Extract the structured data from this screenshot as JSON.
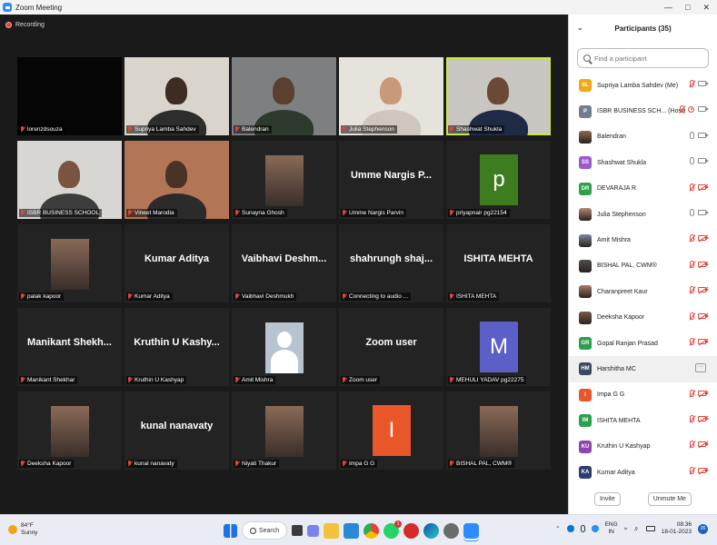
{
  "window": {
    "title": "Zoom Meeting"
  },
  "meeting": {
    "recording_label": "Recording"
  },
  "tiles": [
    {
      "label": "lorenzdsouza",
      "bigname": "",
      "kind": "black"
    },
    {
      "label": "Supriya Lamba Sahdev",
      "bigname": "",
      "kind": "video"
    },
    {
      "label": "Balendran",
      "bigname": "",
      "kind": "video"
    },
    {
      "label": "Julia Stephenson",
      "bigname": "",
      "kind": "video"
    },
    {
      "label": "Shashwat Shukla",
      "bigname": "",
      "kind": "video",
      "active": true
    },
    {
      "label": "ISBR BUSINESS SCHOOL",
      "bigname": "",
      "kind": "video"
    },
    {
      "label": "Vineet Marodia",
      "bigname": "",
      "kind": "video"
    },
    {
      "label": "Sunayna Ghosh",
      "bigname": "",
      "kind": "photo"
    },
    {
      "label": "Umme Nargis Parvin",
      "bigname": "Umme Nargis P...",
      "kind": "name"
    },
    {
      "label": "priyapnair pg22154",
      "bigname": "",
      "kind": "avatar",
      "letter": "p",
      "color": "#3e7d1f"
    },
    {
      "label": "palak kapoor",
      "bigname": "",
      "kind": "photo"
    },
    {
      "label": "Kumar Aditya",
      "bigname": "Kumar Aditya",
      "kind": "name"
    },
    {
      "label": "Vaibhavi Deshmukh",
      "bigname": "Vaibhavi Deshm...",
      "kind": "name"
    },
    {
      "label": "Connecting to audio ...",
      "bigname": "shahrungh shaj...",
      "kind": "name"
    },
    {
      "label": "ISHITA MEHTA",
      "bigname": "ISHITA MEHTA",
      "kind": "name"
    },
    {
      "label": "Manikant Shekhar",
      "bigname": "Manikant Shekh...",
      "kind": "name"
    },
    {
      "label": "Kruthin U Kashyap",
      "bigname": "Kruthin U Kashy...",
      "kind": "name"
    },
    {
      "label": "Amit Mishra",
      "bigname": "",
      "kind": "silhouette"
    },
    {
      "label": "Zoom user",
      "bigname": "Zoom user",
      "kind": "name"
    },
    {
      "label": "MEHULI YADAV pg22275",
      "bigname": "",
      "kind": "avatar",
      "letter": "M",
      "color": "#5b5fc7"
    },
    {
      "label": "Deeksha Kapoor",
      "bigname": "",
      "kind": "photo"
    },
    {
      "label": "kunal nanavaty",
      "bigname": "kunal nanavaty",
      "kind": "name"
    },
    {
      "label": "Niyati Thakur",
      "bigname": "",
      "kind": "photo"
    },
    {
      "label": "Impa G G",
      "bigname": "",
      "kind": "avatar",
      "letter": "I",
      "color": "#e8562a"
    },
    {
      "label": "BISHAL PAL, CWM®",
      "bigname": "",
      "kind": "photo"
    }
  ],
  "panel": {
    "title": "Participants (35)",
    "search_placeholder": "Find a participant",
    "invite_label": "Invite",
    "unmute_label": "Unmute Me",
    "participants": [
      {
        "initials": "SL",
        "color": "#f0a814",
        "name": "Supriya Lamba Sahdev (Me)",
        "mic": "off",
        "cam": "on",
        "rec": false
      },
      {
        "initials": "P",
        "color": "#6f7f8f",
        "name": "ISBR BUSINESS SCH... (Host)",
        "mic": "off",
        "cam": "on",
        "rec": true
      },
      {
        "initials": "",
        "color": "#8a6a55",
        "name": "Balendran",
        "mic": "on",
        "cam": "on",
        "rec": false
      },
      {
        "initials": "SS",
        "color": "#9b59d0",
        "name": "Shashwat Shukla",
        "mic": "on",
        "cam": "on",
        "rec": false
      },
      {
        "initials": "DR",
        "color": "#2aa14a",
        "name": "DEVARAJA R",
        "mic": "off",
        "cam": "off",
        "rec": false
      },
      {
        "initials": "",
        "color": "#b08a70",
        "name": "Julia Stephenson",
        "mic": "on",
        "cam": "on",
        "rec": false
      },
      {
        "initials": "",
        "color": "#7b8896",
        "name": "Amit Mishra",
        "mic": "off",
        "cam": "off",
        "rec": false
      },
      {
        "initials": "",
        "color": "#4d4d4d",
        "name": "BISHAL PAL, CWM®",
        "mic": "off",
        "cam": "off",
        "rec": false
      },
      {
        "initials": "",
        "color": "#a87b66",
        "name": "Charanpreet Kaur",
        "mic": "off",
        "cam": "off",
        "rec": false
      },
      {
        "initials": "",
        "color": "#7a5a48",
        "name": "Deeksha Kapoor",
        "mic": "off",
        "cam": "off",
        "rec": false
      },
      {
        "initials": "GR",
        "color": "#2aa14a",
        "name": "Gopal Ranjan Prasad",
        "mic": "off",
        "cam": "off",
        "rec": false
      },
      {
        "initials": "HM",
        "color": "#3c4a5c",
        "name": "Harshitha MC",
        "mic": "",
        "cam": "",
        "rec": false,
        "more": true
      },
      {
        "initials": "I",
        "color": "#e8562a",
        "name": "Impa G G",
        "mic": "off",
        "cam": "off",
        "rec": false
      },
      {
        "initials": "IM",
        "color": "#2aa14a",
        "name": "ISHITA MEHTA",
        "mic": "off",
        "cam": "off",
        "rec": false
      },
      {
        "initials": "KU",
        "color": "#8e44ad",
        "name": "Kruthin U Kashyap",
        "mic": "off",
        "cam": "off",
        "rec": false
      },
      {
        "initials": "KA",
        "color": "#2c3e6b",
        "name": "Kumar Aditya",
        "mic": "off",
        "cam": "off",
        "rec": false
      }
    ]
  },
  "taskbar": {
    "temperature": "84°F",
    "weather": "Sunny",
    "search_label": "Search",
    "lang_1": "ENG",
    "lang_2": "IN",
    "time": "08:36",
    "date": "18-01-2023",
    "whatsapp_badge": "1",
    "notification_count": "26"
  }
}
